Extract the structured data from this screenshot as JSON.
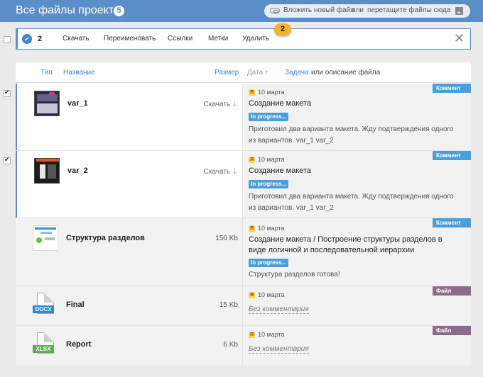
{
  "header": {
    "title": "Все файлы проекта",
    "count": "5",
    "upload": {
      "link_text": "Вложить новый файл",
      "or_text": "или",
      "drop_text": "перетащите файлы сюда"
    }
  },
  "toolbar": {
    "selected_count": "2",
    "actions": [
      "Скачать",
      "Переименовать",
      "Ссылки",
      "Метки",
      "Удалить"
    ],
    "close_label": "✕",
    "badge": "2"
  },
  "columns": {
    "type": "Тип",
    "name": "Название",
    "size": "Размер",
    "date": "Дата ↑",
    "task": "Задача",
    "desc": "или описание файла"
  },
  "rows": [
    {
      "name": "var_1",
      "download_label": "Скачать",
      "date": "10 марта",
      "task": "Создание макета",
      "status": "In progress...",
      "comment": "Приготовил два варианта макета. Жду подтверждения одного из вариантов. var_1 var_2",
      "tag": "Коммент",
      "checked": true
    },
    {
      "name": "var_2",
      "download_label": "Скачать",
      "date": "10 марта",
      "task": "Создание макета",
      "status": "In progress...",
      "comment": "Приготовил два варианта макета. Жду подтверждения одного из вариантов. var_1 var_2",
      "tag": "Коммент",
      "checked": true
    },
    {
      "name": "Структура разделов",
      "size": "150 Kb",
      "date": "10 марта",
      "task": "Создание макета / Построение структуры разделов в виде логичной и последовательной иерархии",
      "status": "In progress...",
      "comment": "Структура разделов готова!",
      "tag": "Коммент",
      "checked": false
    },
    {
      "name": "Final",
      "size": "15 Kb",
      "filetype": "DOCX",
      "date": "10 марта",
      "no_comment": "Без комментария",
      "tag": "Файл",
      "checked": false
    },
    {
      "name": "Report",
      "size": "6 Kb",
      "filetype": "XLSX",
      "date": "10 марта",
      "no_comment": "Без комментария",
      "tag": "Файл",
      "checked": false
    }
  ],
  "colors": {
    "accent": "#5b8ec9",
    "status": "#4b9fd8",
    "file_tag": "#8e6b8c",
    "badge": "#f5b22c"
  }
}
